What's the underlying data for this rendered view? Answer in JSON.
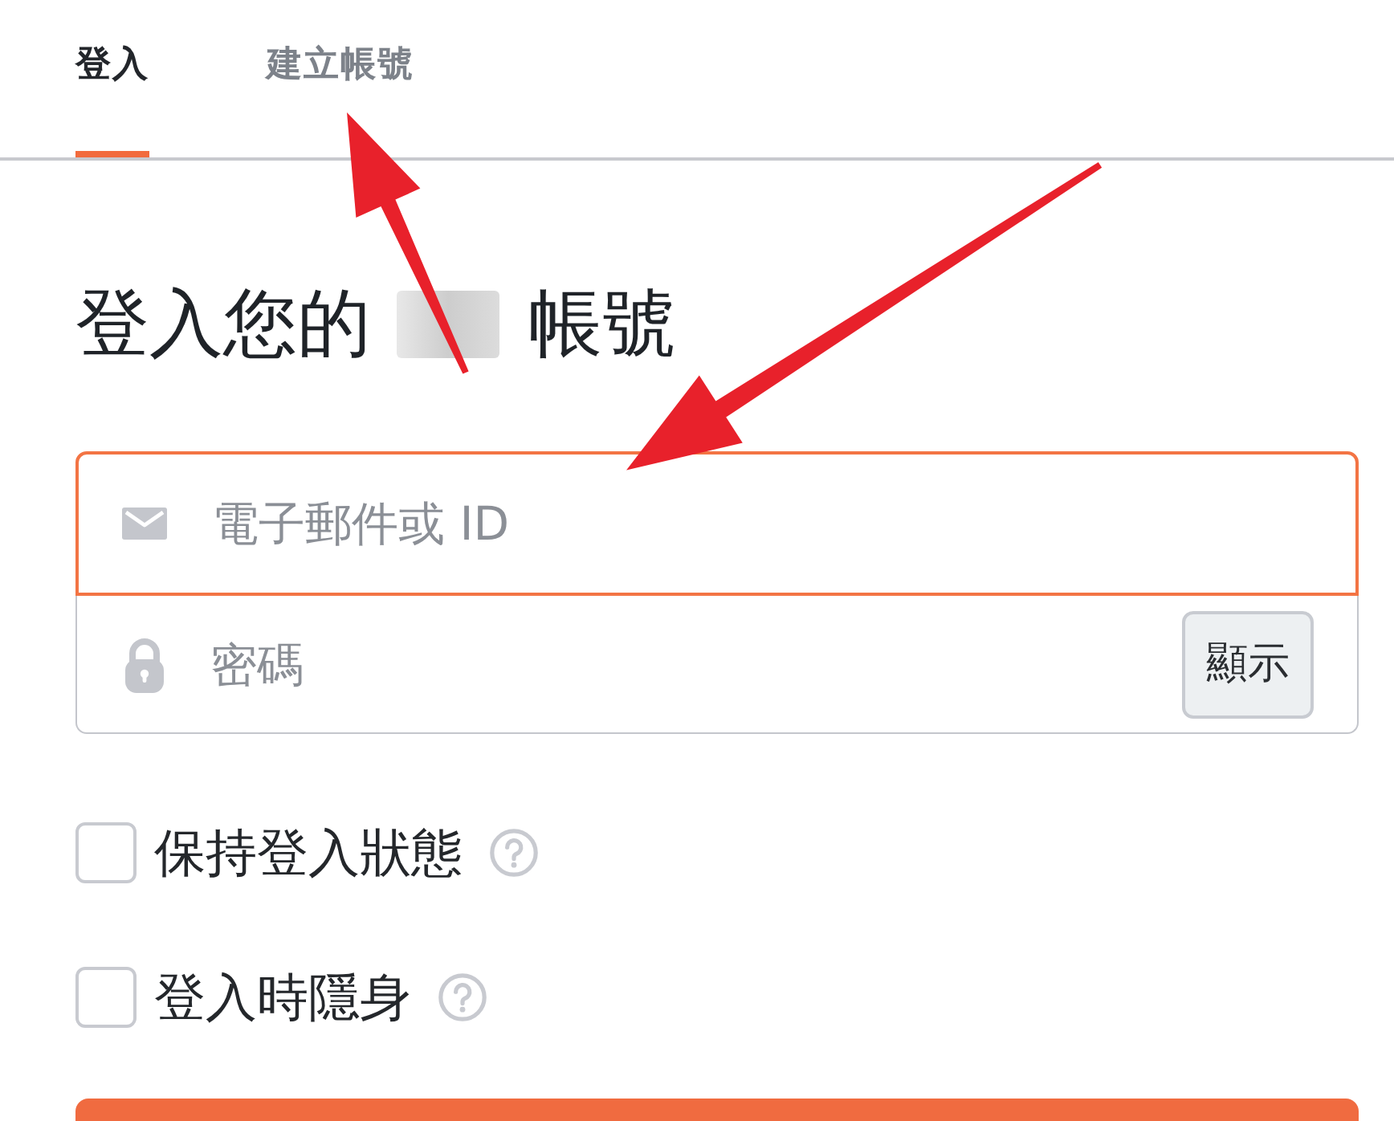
{
  "tabs": [
    {
      "label": "登入",
      "selected": true
    },
    {
      "label": "建立帳號",
      "selected": false
    }
  ],
  "heading": {
    "before": "登入您的",
    "redacted": true,
    "after": "帳號"
  },
  "email_field": {
    "placeholder": "電子郵件或 ID",
    "focused": true
  },
  "password_field": {
    "placeholder": "密碼",
    "focused": false,
    "show_button": "顯示"
  },
  "options": [
    {
      "label": "保持登入狀態",
      "checked": false,
      "help": true
    },
    {
      "label": "登入時隱身",
      "checked": false,
      "help": true
    }
  ],
  "primary_button": {
    "disabled": false
  },
  "annotations": [
    {
      "kind": "arrow"
    },
    {
      "kind": "arrow"
    }
  ]
}
